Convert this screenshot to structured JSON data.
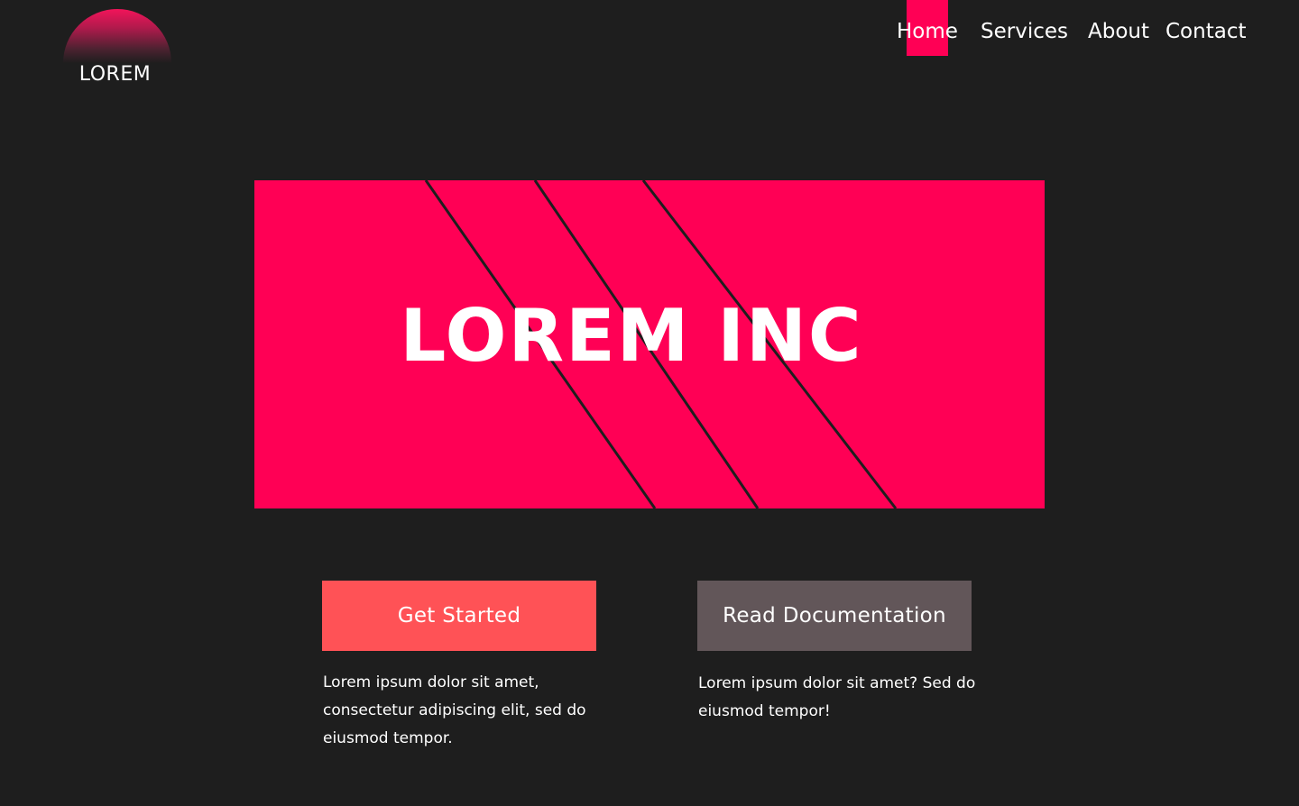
{
  "brand": {
    "logo_text": "LOREM",
    "accent_color": "#ff0055"
  },
  "nav": {
    "items": [
      {
        "label": "Home",
        "active": true
      },
      {
        "label": "Services",
        "active": false
      },
      {
        "label": "About",
        "active": false
      },
      {
        "label": "Contact",
        "active": false
      }
    ]
  },
  "hero": {
    "title": "LOREM INC",
    "background_color": "#ff0055"
  },
  "actions": {
    "primary": {
      "label": "Get Started",
      "color": "#ff5256",
      "description": "Lorem ipsum dolor sit amet, consectetur adipiscing elit, sed do eiusmod tempor."
    },
    "secondary": {
      "label": "Read Documentation",
      "color": "#625659",
      "description": "Lorem ipsum dolor sit amet? Sed do eiusmod tempor!"
    }
  }
}
